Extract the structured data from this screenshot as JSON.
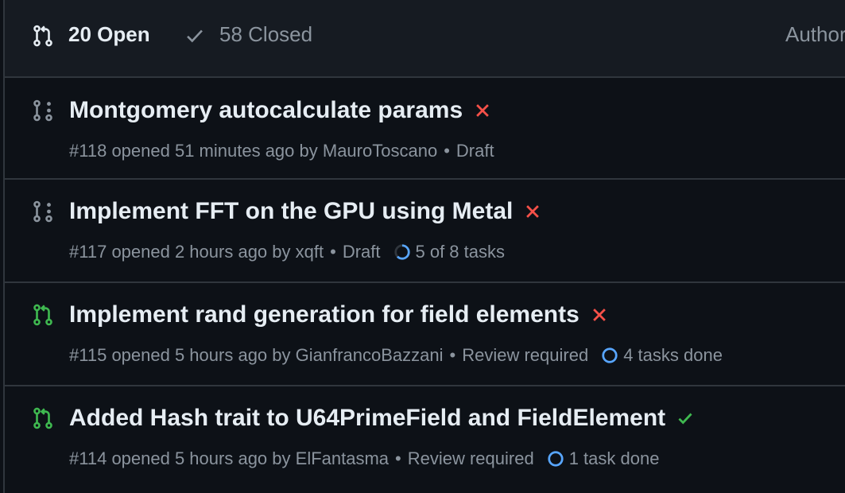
{
  "header": {
    "open_label": "20 Open",
    "closed_label": "58 Closed",
    "author_label": "Author",
    "open_icon": "git-pull-request-icon",
    "closed_icon": "check-icon"
  },
  "pull_requests": [
    {
      "title": "Montgomery autocalculate params",
      "number": "#118",
      "opened": "opened 51 minutes ago by",
      "author": "MauroToscano",
      "state": "Draft",
      "icon": "git-pull-request-draft-icon",
      "ci_status": "failure",
      "tasks": ""
    },
    {
      "title": "Implement FFT on the GPU using Metal",
      "number": "#117",
      "opened": "opened 2 hours ago by",
      "author": "xqft",
      "state": "Draft",
      "icon": "git-pull-request-draft-icon",
      "ci_status": "failure",
      "tasks": "5 of 8 tasks",
      "tasks_progress": 0.625
    },
    {
      "title": "Implement rand generation for field elements",
      "number": "#115",
      "opened": "opened 5 hours ago by",
      "author": "GianfrancoBazzani",
      "state": "Review required",
      "icon": "git-pull-request-icon",
      "ci_status": "failure",
      "tasks": "4 tasks done",
      "tasks_progress": 1
    },
    {
      "title": "Added Hash trait to U64PrimeField and FieldElement",
      "number": "#114",
      "opened": "opened 5 hours ago by",
      "author": "ElFantasma",
      "state": "Review required",
      "icon": "git-pull-request-icon",
      "ci_status": "success",
      "tasks": "1 task done",
      "tasks_progress": 1
    }
  ],
  "colors": {
    "background": "#0d1117",
    "header_bg": "#161b22",
    "border": "#30363d",
    "text": "#e6edf3",
    "muted": "#8b949e",
    "open_green": "#3fb950",
    "fail_red": "#f85149",
    "task_blue": "#58a6ff"
  }
}
